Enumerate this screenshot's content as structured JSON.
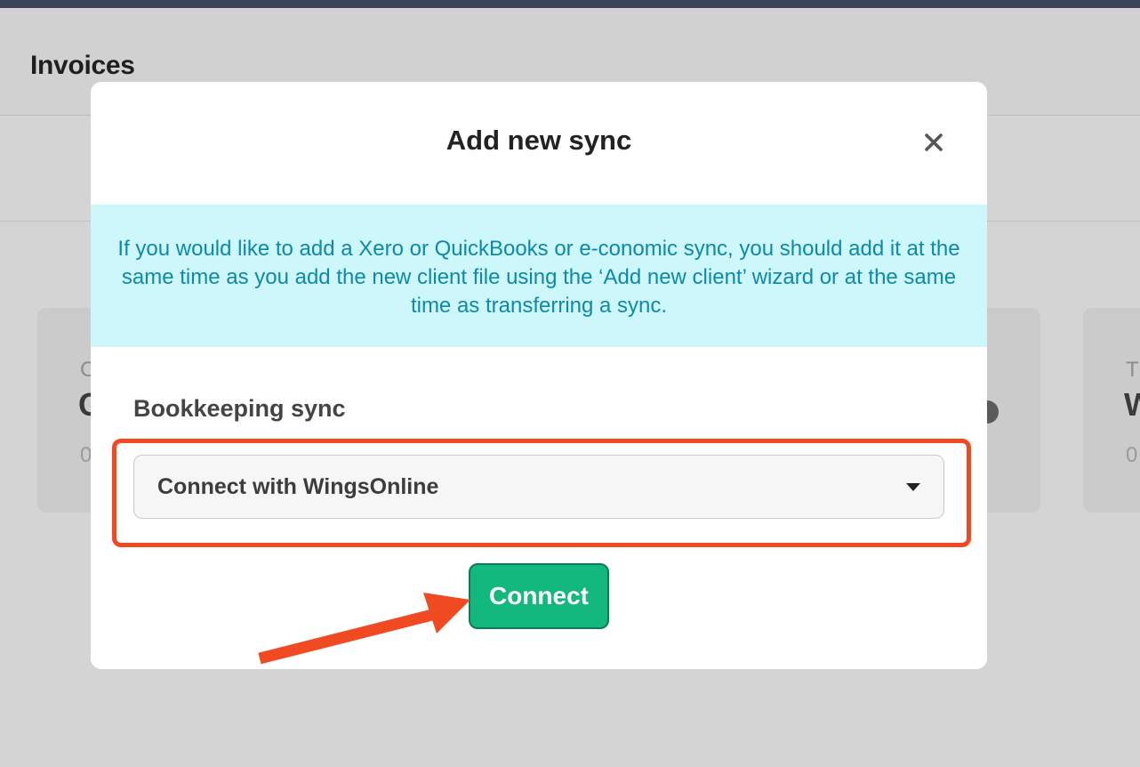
{
  "page": {
    "title": "Invoices"
  },
  "background_cards": {
    "left": {
      "label": "C",
      "value": "C",
      "sub": "0"
    },
    "right": {
      "label": "T",
      "value": "W",
      "sub": "0"
    }
  },
  "modal": {
    "title": "Add new sync",
    "close_icon": "close-icon",
    "info_text": "If you would like to add a Xero or QuickBooks or e-conomic sync, you should add it at the same time as you add the new client file using the ‘Add new client’ wizard or at the same time as transferring a sync.",
    "field_label": "Bookkeeping sync",
    "select_value": "Connect with WingsOnline",
    "connect_label": "Connect"
  },
  "colors": {
    "info_bg": "#cdf7fb",
    "info_text": "#0d8aa8",
    "connect_bg": "#12b87d",
    "highlight": "#f04a23",
    "topbar": "#3b4458"
  }
}
